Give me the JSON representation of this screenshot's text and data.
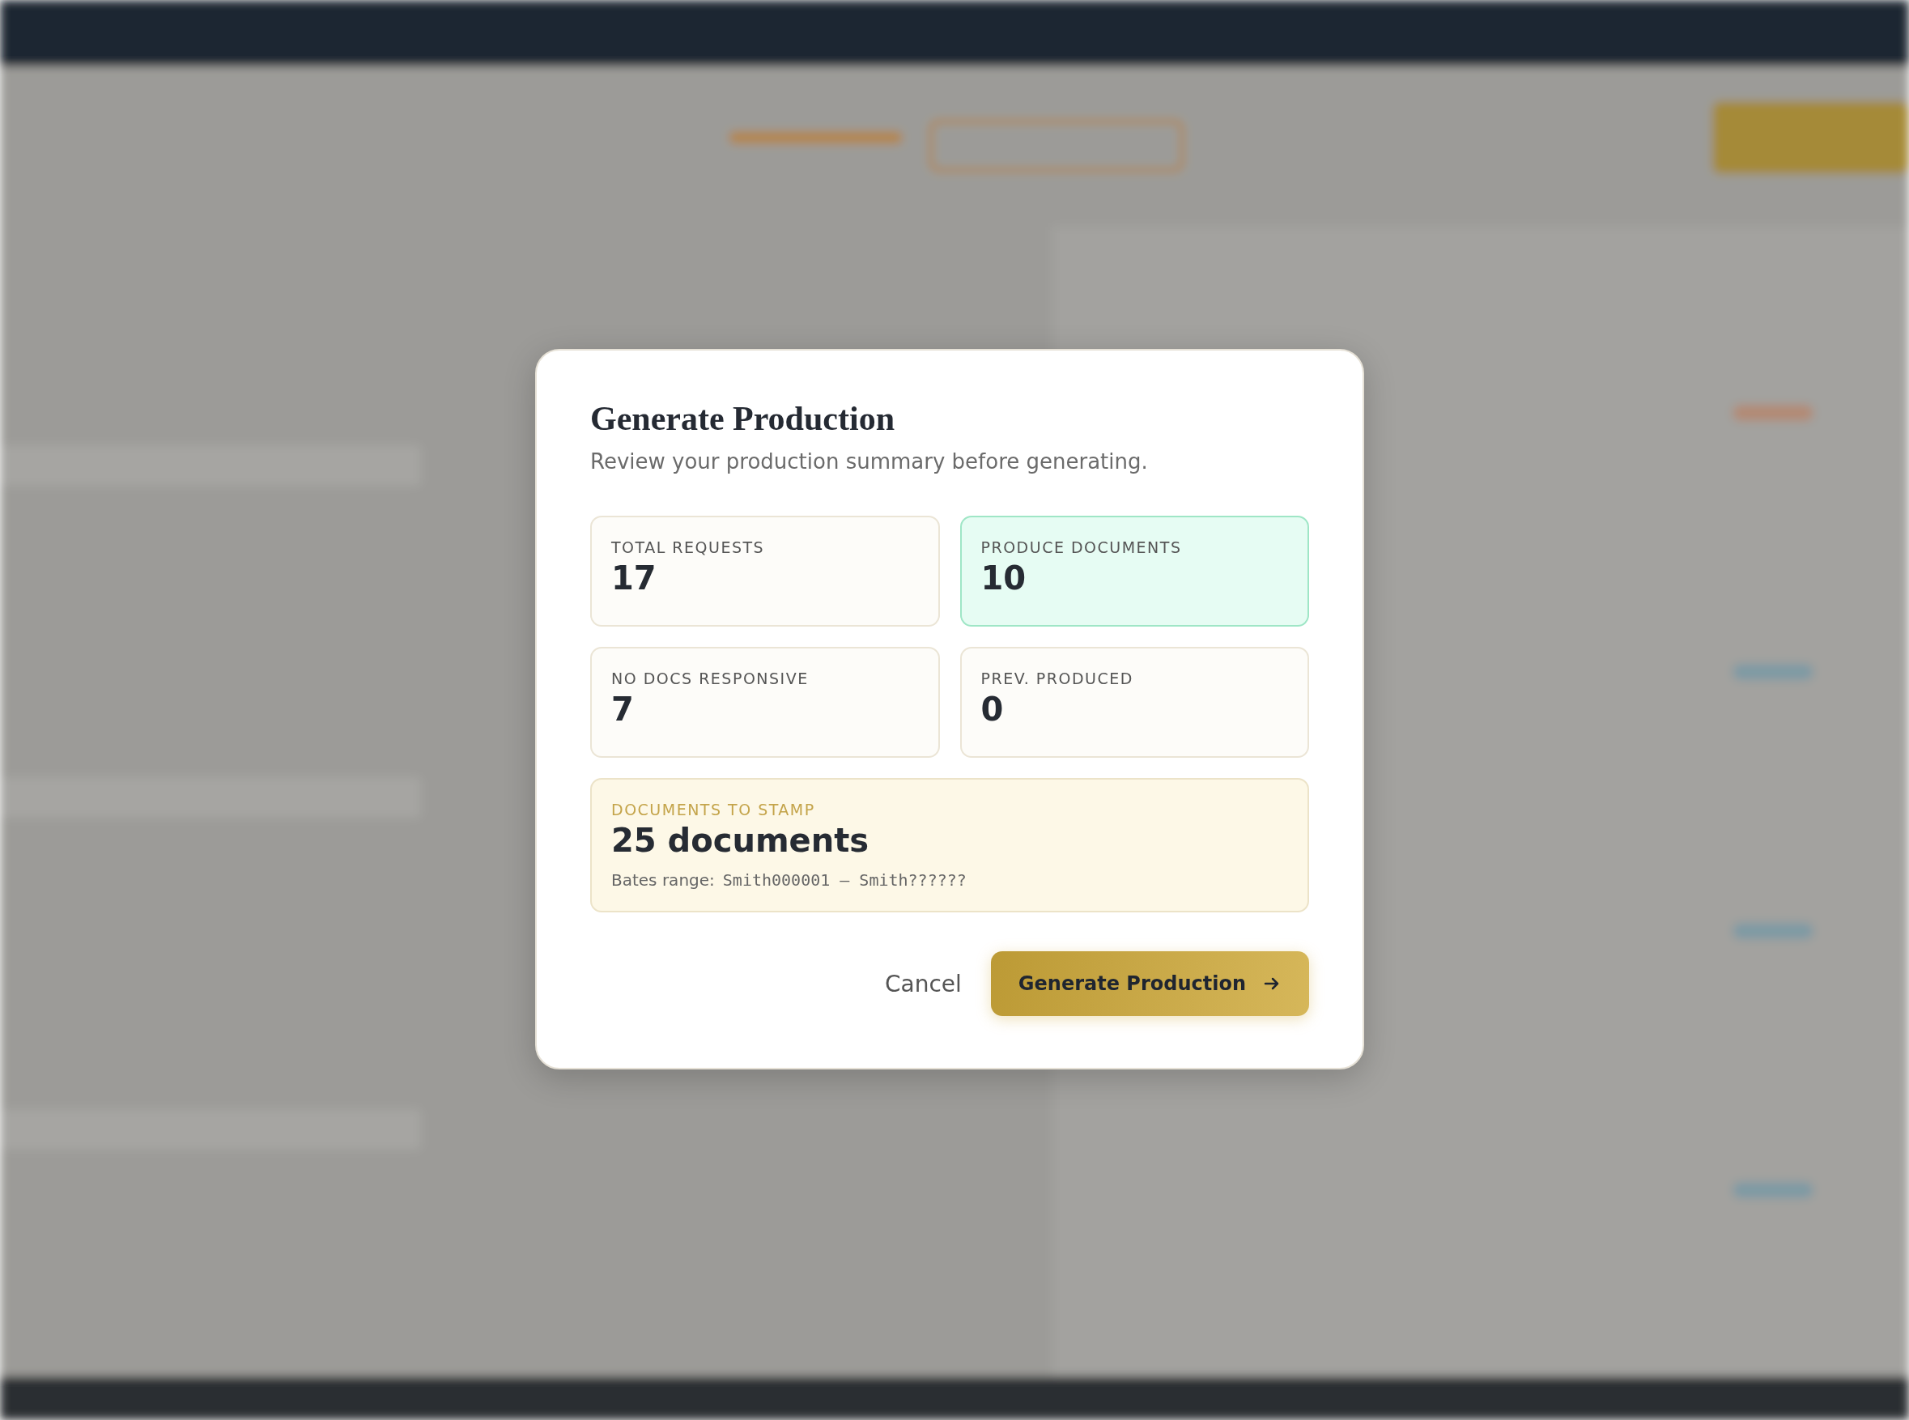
{
  "dialog": {
    "title": "Generate Production",
    "subtitle": "Review your production summary before generating.",
    "stats": [
      {
        "label": "TOTAL REQUESTS",
        "value": "17",
        "kind": "plain"
      },
      {
        "label": "PRODUCE DOCUMENTS",
        "value": "10",
        "kind": "highlight"
      },
      {
        "label": "NO DOCS RESPONSIVE",
        "value": "7",
        "kind": "plain"
      },
      {
        "label": "PREV. PRODUCED",
        "value": "0",
        "kind": "plain"
      }
    ],
    "stamp": {
      "label": "DOCUMENTS TO STAMP",
      "value": "25 documents",
      "range_label": "Bates range:",
      "range_value": "Smith000001 – Smith??????"
    },
    "buttons": [
      {
        "label": "Cancel",
        "kind": "secondary"
      },
      {
        "label": "Generate Production",
        "kind": "primary"
      }
    ]
  }
}
